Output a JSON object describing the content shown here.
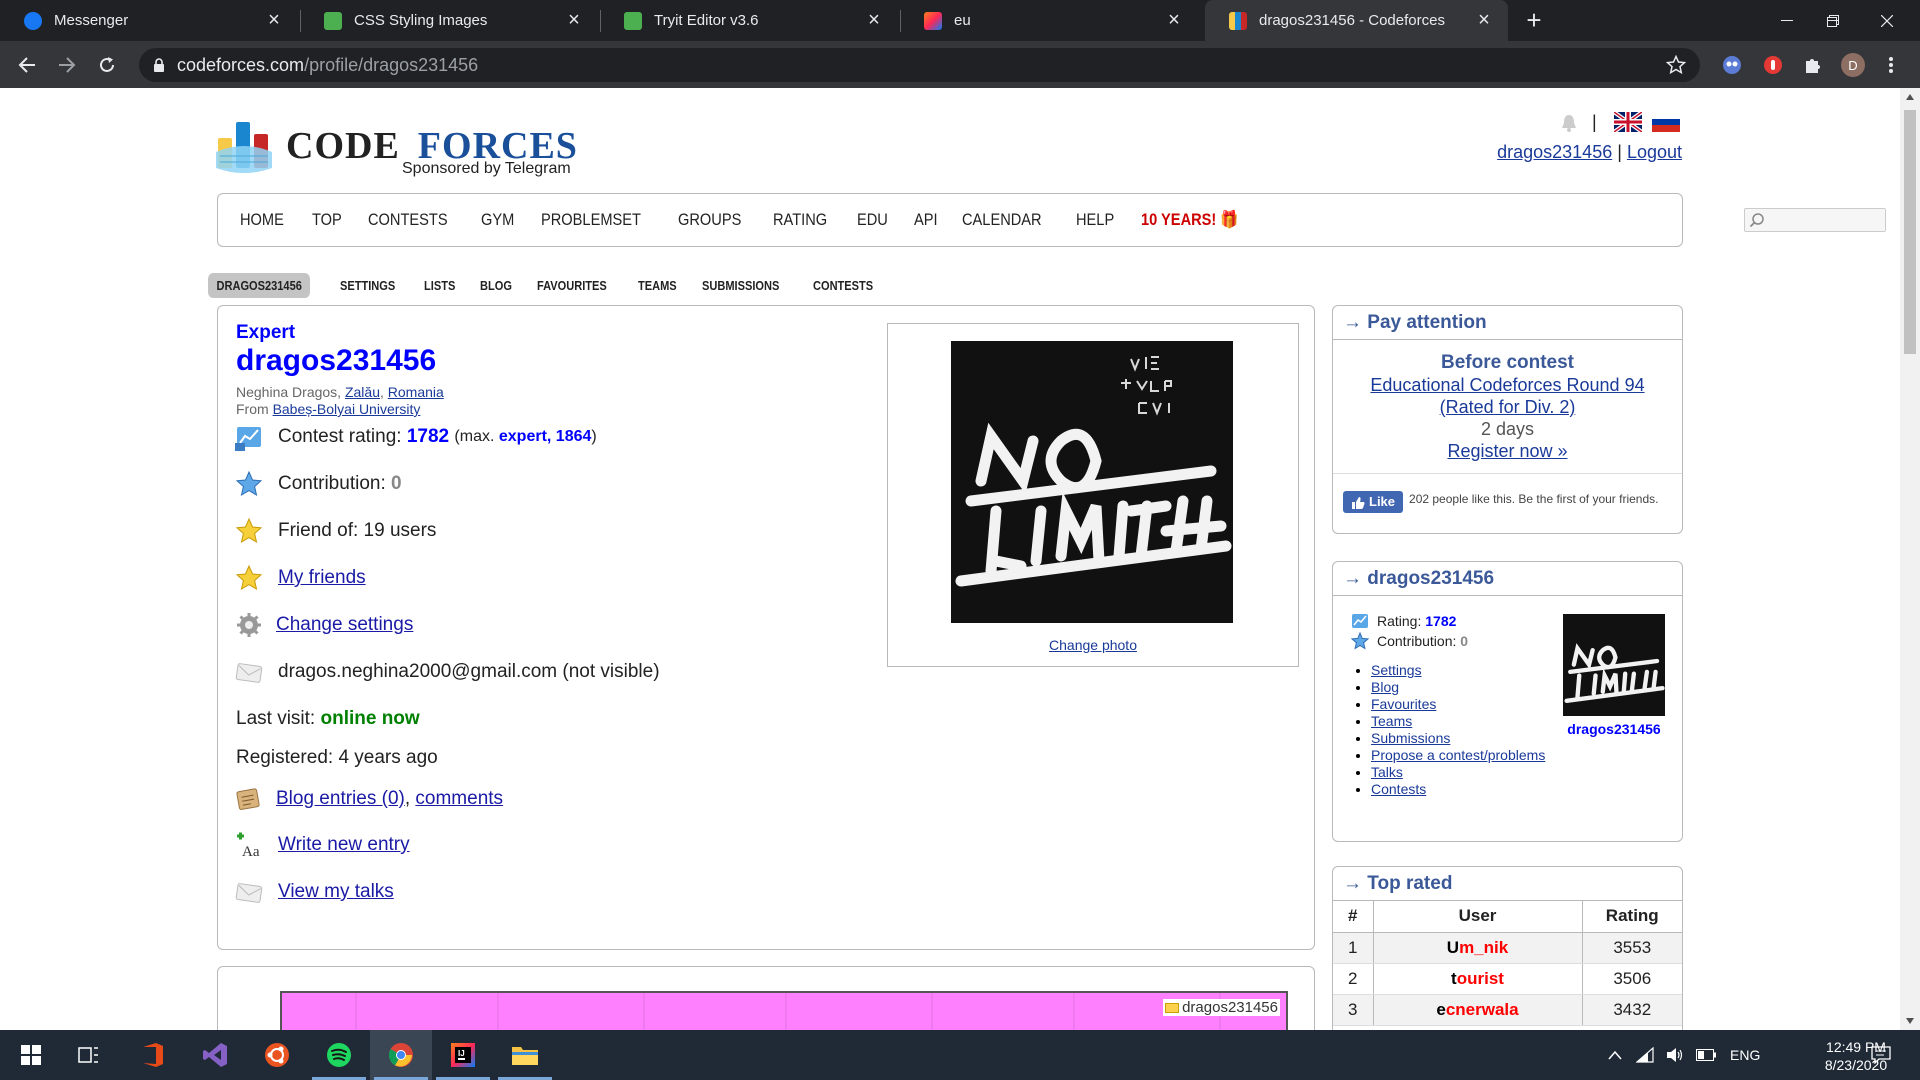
{
  "browser": {
    "tabs": [
      {
        "title": "Messenger",
        "icon": "messenger-icon"
      },
      {
        "title": "CSS Styling Images",
        "icon": "w3schools-icon"
      },
      {
        "title": "Tryit Editor v3.6",
        "icon": "w3schools-icon"
      },
      {
        "title": "eu",
        "icon": "intellij-icon"
      },
      {
        "title": "dragos231456 - Codeforces",
        "icon": "codeforces-icon",
        "active": true
      }
    ],
    "url_host": "codeforces.com",
    "url_path": "/profile/dragos231456",
    "profile_initial": "D"
  },
  "site": {
    "logo_part1": "CODE",
    "logo_part2": "FORCES",
    "logo_sub": "Sponsored by Telegram",
    "user_handle": "dragos231456",
    "separator": "|",
    "logout": "Logout",
    "menu": [
      "HOME",
      "TOP",
      "CONTESTS",
      "GYM",
      "PROBLEMSET",
      "GROUPS",
      "RATING",
      "EDU",
      "API",
      "CALENDAR",
      "HELP"
    ],
    "menu_special": "10 YEARS!",
    "submenu": [
      "DRAGOS231456",
      "SETTINGS",
      "LISTS",
      "BLOG",
      "FAVOURITES",
      "TEAMS",
      "SUBMISSIONS",
      "CONTESTS"
    ]
  },
  "profile": {
    "rank": "Expert",
    "handle": "dragos231456",
    "name": "Neghina Dragos",
    "city": "Zalău",
    "country": "Romania",
    "from_label": "From",
    "organization": "Babeș-Bolyai University",
    "rating_label": "Contest rating:",
    "rating": "1782",
    "max_prefix": "(max.",
    "max_rank": "expert, 1864",
    "max_suffix": ")",
    "contribution_label": "Contribution:",
    "contribution": "0",
    "friend_of": "Friend of: 19 users",
    "my_friends": "My friends",
    "change_settings": "Change settings",
    "email": "dragos.neghina2000@gmail.com (not visible)",
    "last_visit_label": "Last visit:",
    "last_visit": "online now",
    "registered": "Registered: 4 years ago",
    "blog_entries": "Blog entries (0)",
    "comments": "comments",
    "write_entry": "Write new entry",
    "view_talks": "View my talks",
    "change_photo": "Change photo",
    "graph_legend": "dragos231456"
  },
  "sidebar": {
    "pay_title": "→ Pay attention",
    "before_contest": "Before contest",
    "contest_name": "Educational Codeforces Round 94 (Rated for Div. 2)",
    "countdown": "2 days",
    "register": "Register now »",
    "fb_like": "Like",
    "fb_text": "202 people like this. Be the first of your friends.",
    "me_title": "→ dragos231456",
    "me_rating_label": "Rating:",
    "me_rating": "1782",
    "me_contrib_label": "Contribution:",
    "me_contrib": "0",
    "me_links": [
      "Settings",
      "Blog",
      "Favourites",
      "Teams",
      "Submissions",
      "Propose a contest/problems",
      "Talks",
      "Contests"
    ],
    "me_handle": "dragos231456",
    "top_title": "→ Top rated",
    "top_headers": [
      "#",
      "User",
      "Rating"
    ],
    "top_rows": [
      {
        "rank": "1",
        "first": "U",
        "rest": "m_nik",
        "rating": "3553"
      },
      {
        "rank": "2",
        "first": "t",
        "rest": "ourist",
        "rating": "3506"
      },
      {
        "rank": "3",
        "first": "e",
        "rest": "cnerwala",
        "rating": "3432"
      }
    ]
  },
  "taskbar": {
    "lang": "ENG",
    "time": "12:49 PM",
    "date": "8/23/2020"
  },
  "colors": {
    "expert": "#0000ff",
    "legendary": "#ff0000",
    "online": "#008000",
    "graph_fill": "#ff80ff"
  }
}
